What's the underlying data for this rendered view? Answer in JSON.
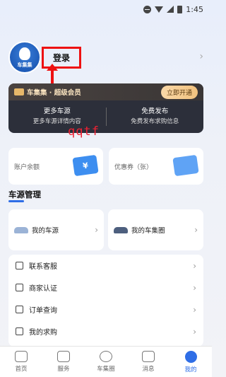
{
  "status_bar": {
    "time": "1:45"
  },
  "profile": {
    "logo_text": "车集集",
    "login_label": "登录"
  },
  "vip": {
    "title": "车集集 · 超级会员",
    "button": "立即开通",
    "left": {
      "title": "更多车源",
      "subtitle": "更多车源详情内容"
    },
    "right": {
      "title": "免费发布",
      "subtitle": "免费发布求购信息"
    }
  },
  "annotation": {
    "text": "qqtf"
  },
  "balance": {
    "account_label": "账户余额",
    "coupon_label": "优惠券（张）"
  },
  "car_section": {
    "title": "车源管理",
    "items": [
      {
        "label": "我的车源"
      },
      {
        "label": "我的车集圈"
      }
    ]
  },
  "menu": {
    "items": [
      {
        "label": "联系客服",
        "icon": "headset-icon"
      },
      {
        "label": "商家认证",
        "icon": "shield-icon"
      },
      {
        "label": "订单查询",
        "icon": "order-icon"
      },
      {
        "label": "我的求购",
        "icon": "request-icon"
      }
    ]
  },
  "tab_bar": {
    "items": [
      {
        "label": "首页",
        "icon": "home-icon"
      },
      {
        "label": "服务",
        "icon": "service-icon"
      },
      {
        "label": "车集圈",
        "icon": "circle-icon"
      },
      {
        "label": "消息",
        "icon": "message-icon"
      },
      {
        "label": "我的",
        "icon": "profile-icon",
        "active": true
      }
    ]
  },
  "colors": {
    "accent": "#2f6ee6",
    "annotation_red": "#e11111",
    "vip_dark": "#2c2f3a"
  }
}
